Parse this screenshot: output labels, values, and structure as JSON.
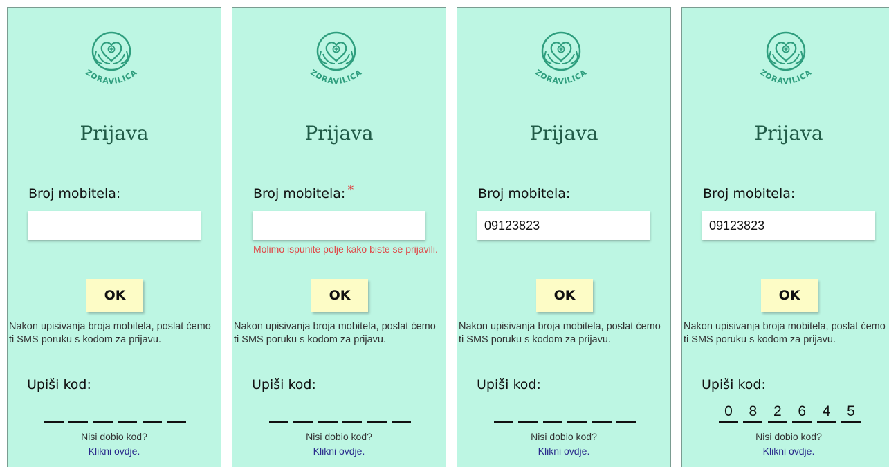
{
  "brand": {
    "name": "ZDRAVILICA",
    "accent": "#2f9e7e",
    "background": "#bdf6e3"
  },
  "screens": [
    {
      "title": "Prijava",
      "phone_label": "Broj mobitela:",
      "phone_required_mark": "",
      "phone_value": "",
      "error_text": "",
      "ok_label": "OK",
      "info_text": "Nakon upisivanja broja mobitela, poslat ćemo ti SMS poruku s kodom za prijavu.",
      "code_label": "Upiši kod:",
      "code_digits": [
        "",
        "",
        "",
        "",
        "",
        ""
      ],
      "resend_question": "Nisi dobio kod?",
      "resend_link": "Klikni ovdje."
    },
    {
      "title": "Prijava",
      "phone_label": "Broj mobitela:",
      "phone_required_mark": "*",
      "phone_value": "",
      "error_text": "Molimo ispunite polje kako biste se prijavili.",
      "ok_label": "OK",
      "info_text": "Nakon upisivanja broja mobitela, poslat ćemo ti SMS poruku s kodom za prijavu.",
      "code_label": "Upiši kod:",
      "code_digits": [
        "",
        "",
        "",
        "",
        "",
        ""
      ],
      "resend_question": "Nisi dobio kod?",
      "resend_link": "Klikni ovdje."
    },
    {
      "title": "Prijava",
      "phone_label": "Broj mobitela:",
      "phone_required_mark": "",
      "phone_value": "09123823",
      "error_text": "",
      "ok_label": "OK",
      "info_text": "Nakon upisivanja broja mobitela, poslat ćemo ti SMS poruku s kodom za prijavu.",
      "code_label": "Upiši kod:",
      "code_digits": [
        "",
        "",
        "",
        "",
        "",
        ""
      ],
      "resend_question": "Nisi dobio kod?",
      "resend_link": "Klikni ovdje."
    },
    {
      "title": "Prijava",
      "phone_label": "Broj mobitela:",
      "phone_required_mark": "",
      "phone_value": "09123823",
      "error_text": "",
      "ok_label": "OK",
      "info_text": "Nakon upisivanja broja mobitela, poslat ćemo ti SMS poruku s kodom za prijavu.",
      "code_label": "Upiši kod:",
      "code_digits": [
        "0",
        "8",
        "2",
        "6",
        "4",
        "5"
      ],
      "resend_question": "Nisi dobio kod?",
      "resend_link": "Klikni ovdje."
    }
  ]
}
